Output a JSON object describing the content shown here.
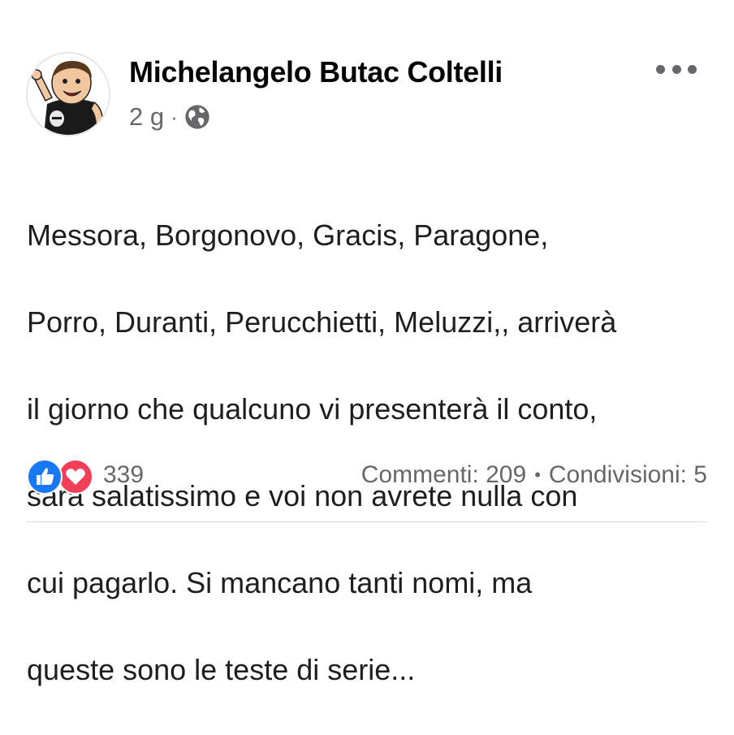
{
  "post": {
    "author": "Michelangelo Butac Coltelli",
    "timestamp": "2 g",
    "meta_separator": "·",
    "privacy_icon": "globe-icon",
    "more_icon": "more-options-icon",
    "text_lines": [
      "Messora, Borgonovo, Gracis, Paragone,",
      "Porro, Duranti, Perucchietti, Meluzzi,, arriverà",
      "il giorno che qualcuno vi presenterà il conto,",
      "sarà salatissimo e voi non avrete nulla con",
      "cui pagarlo. Si mancano tanti nomi, ma",
      "queste sono le teste di serie..."
    ]
  },
  "reactions": {
    "count": "339",
    "types": [
      "like-reaction-icon",
      "love-reaction-icon"
    ]
  },
  "engagement": {
    "comments": "Commenti: 209",
    "separator": "•",
    "shares": "Condivisioni: 5"
  },
  "colors": {
    "text": "#1c1e21",
    "muted": "#65676b",
    "like_blue": "#1877f2",
    "love_red": "#f33e58"
  }
}
